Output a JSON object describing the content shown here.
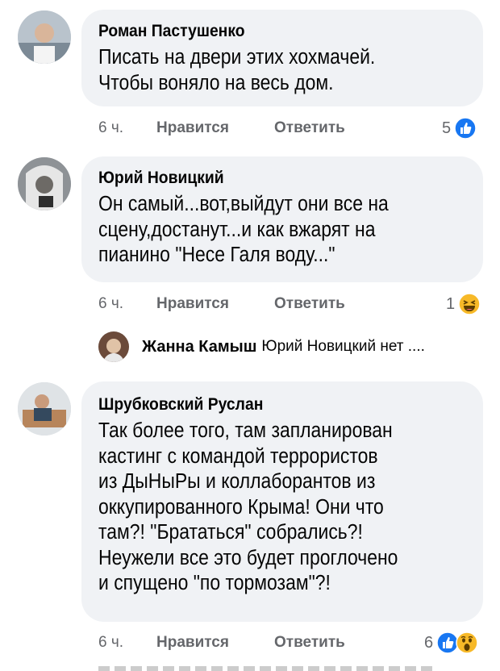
{
  "comments": [
    {
      "author": "Роман Пастушенко",
      "lines": [
        "Писать на двери этих хохмачей.",
        "Чтобы воняло на весь дом."
      ],
      "time": "6 ч.",
      "like_label": "Нравится",
      "reply_label": "Ответить",
      "reaction_count": "5",
      "reactions": [
        "like-icon"
      ]
    },
    {
      "author": "Юрий Новицкий",
      "lines": [
        "Он самый...вот,выйдут они все на",
        "сцену,достанут...и как вжарят на",
        "пианино \"Несе Галя воду...\""
      ],
      "time": "6 ч.",
      "like_label": "Нравится",
      "reply_label": "Ответить",
      "reaction_count": "1",
      "reactions": [
        "haha-icon"
      ]
    },
    {
      "author": "Шрубковский Руслан",
      "lines": [
        "Так более того, там запланирован",
        "кастинг с командой террористов",
        "из ДыНыРы и коллаборантов из",
        "оккупированного Крыма! Они что",
        "там?! \"Брататься\" собрались?!",
        "Неужели все это будет проглочено",
        "и спущено \"по тормозам\"?!"
      ],
      "time": "6 ч.",
      "like_label": "Нравится",
      "reply_label": "Ответить",
      "reaction_count": "6",
      "reactions": [
        "like-icon",
        "wow-icon"
      ]
    }
  ],
  "reply": {
    "author": "Жанна Камыш",
    "preview": "Юрий Новицкий нет ...."
  },
  "colors": {
    "bubble": "#f0f2f5",
    "meta_text": "#65676b",
    "like_blue": "#1877f2",
    "emoji_yellow": "#f7b928"
  }
}
